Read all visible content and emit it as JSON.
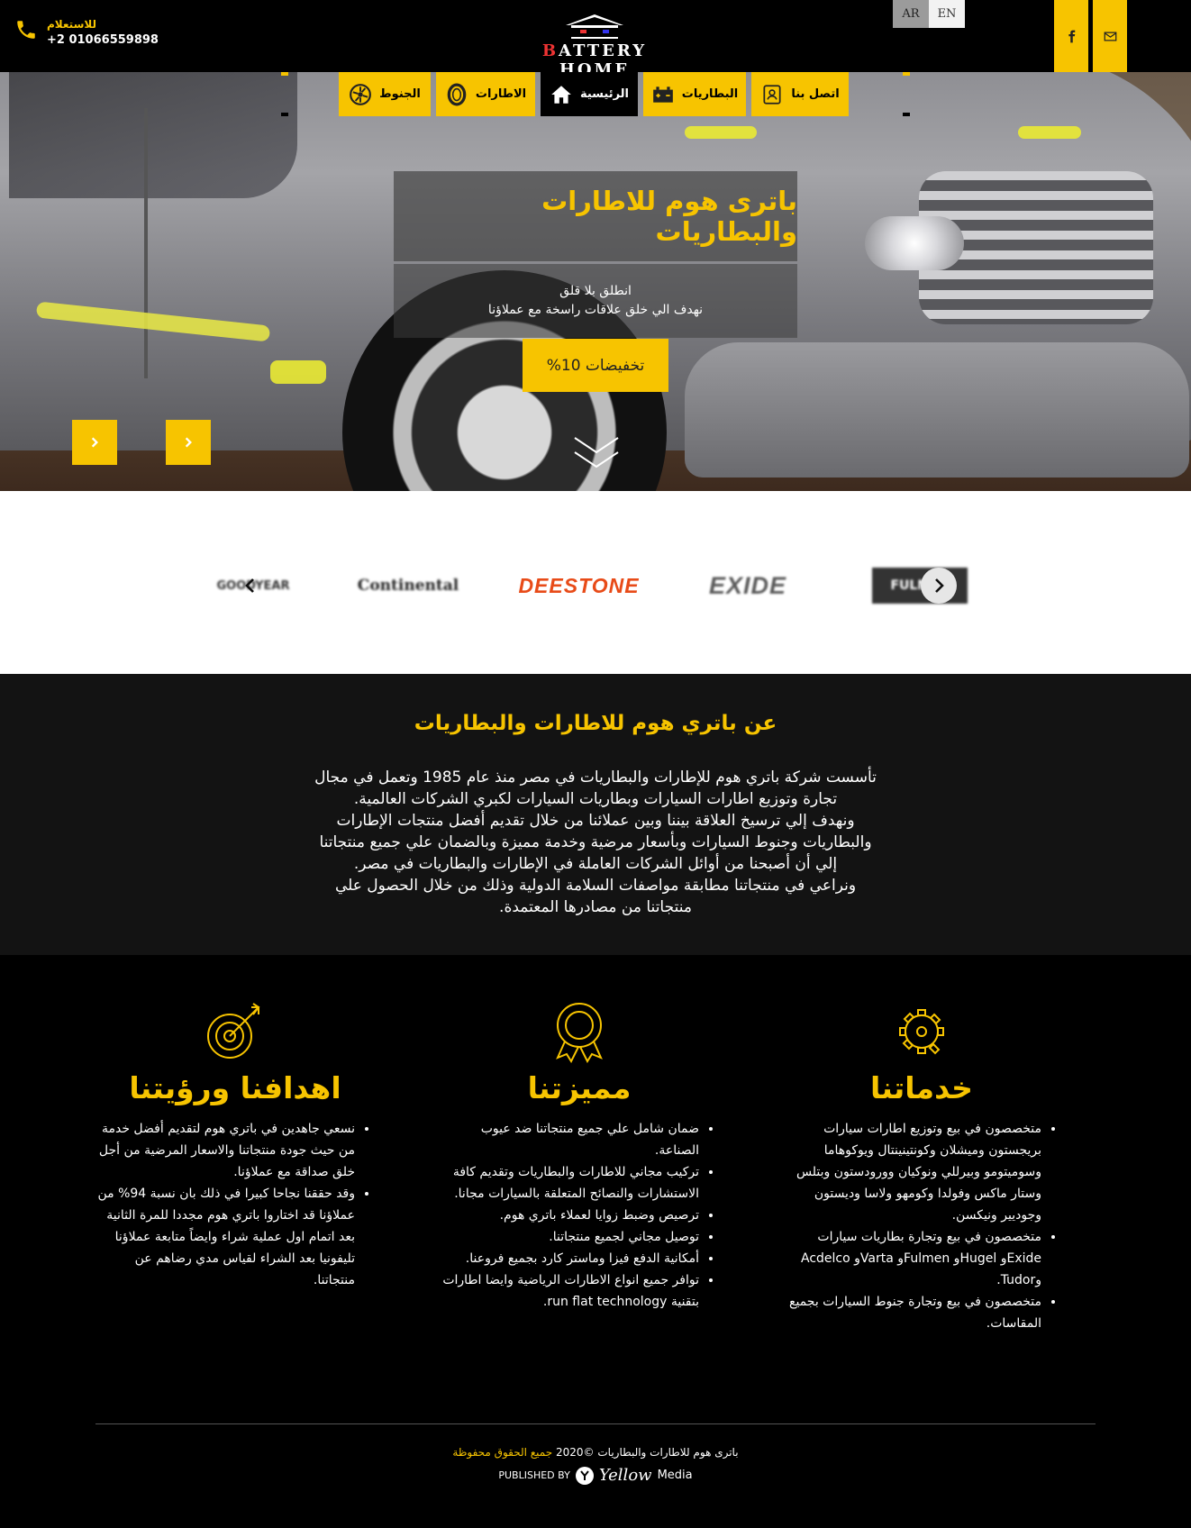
{
  "header": {
    "phone_label": "للاستعلام",
    "phone_number": "+2 01066559898",
    "logo": {
      "first_letter": "B",
      "rest": "ATTERY H",
      "o": "O",
      "end": "ME"
    },
    "lang_ar": "AR",
    "lang_en": "EN",
    "social": [
      {
        "icon": "facebook-icon"
      },
      {
        "icon": "mail-icon"
      }
    ]
  },
  "nav": {
    "items": [
      {
        "label": "الجنوط",
        "icon": "rim-icon"
      },
      {
        "label": "الاطارات",
        "icon": "tire-icon"
      },
      {
        "label": "الرئيسية",
        "icon": "home-icon",
        "active": true
      },
      {
        "label": "البطاريات",
        "icon": "battery-icon"
      },
      {
        "label": "اتصل بنا",
        "icon": "contact-icon"
      }
    ]
  },
  "hero": {
    "title": "باترى هوم للاطارات والبطاريات",
    "line1": "انطلق بلا قلق",
    "line2": "نهدف الي خلق علاقات راسخة مع عملاؤنا",
    "cta": "تخفيضات 10%"
  },
  "brands": {
    "items": [
      "GOODYEAR",
      "Continental",
      "DEESTONE",
      "EXIDE",
      "FULMEN"
    ]
  },
  "about": {
    "title": "عن باتري هوم للاطارات والبطاريات",
    "lines": [
      "تأسست شركة باتري هوم للإطارات والبطاريات في مصر منذ عام 1985 وتعمل في مجال",
      "تجارة وتوزيع اطارات السيارات وبطاريات السيارات لكبري الشركات العالمية.",
      "ونهدف إلي ترسيخ العلاقة بيننا وبين عملائنا من خلال تقديم أفضل منتجات الإطارات",
      "والبطاريات وجنوط السيارات وبأسعار مرضية وخدمة مميزة وبالضمان علي جميع منتجاتنا",
      "إلي أن أصبحنا من أوائل الشركات العاملة في الإطارات والبطاريات في مصر.",
      "ونراعي في منتجاتنا مطابقة مواصفات السلامة الدولية وذلك من خلال الحصول علي",
      "منتجاتنا من مصادرها المعتمدة."
    ]
  },
  "features": {
    "services": {
      "title": "خدماتنا",
      "icon": "gear-icon",
      "items": [
        "متخصصون في بيع وتوزيع اطارات سيارات بريجستون وميشلان وكونتينينتال ويوكوهاما وسوميتومو وبيرللي ونوكيان وورودستون وبتلس وستار ماكس وفولدا وكومهو ولاسا وديستون وجوديير ونيكسن.",
        "متخصصون في بيع وتجارة بطاريات سيارات Exideو Hugelو Fulmenو Vartaو Acdelco وTudor.",
        "متخصصون في بيع وتجارة جنوط السيارات بجميع المقاسات."
      ]
    },
    "advantages": {
      "title": "مميزتنا",
      "icon": "award-badge-icon",
      "items": [
        "ضمان شامل علي جميع منتجاتنا ضد عيوب الصناعة.",
        "تركيب مجاني للاطارات والبطاريات وتقديم كافة الاستشارات والنصائح المتعلقة بالسيارات مجانا.",
        "ترصيص وضبط زوايا لعملاء باتري هوم.",
        "توصيل مجاني لجميع منتجاتنا.",
        "أمكانية الدفع فيزا وماستر كارد بجميع فروعنا.",
        "توافر جميع انواع الاطارات الرياضية وايضا اطارات بتقنية run flat technology."
      ]
    },
    "goals": {
      "title": "اهدافنا ورؤيتنا",
      "icon": "target-icon",
      "items": [
        "نسعي جاهدين في باتري هوم لتقديم أفضل خدمة من حيث جودة منتجاتنا والاسعار المرضية من أجل خلق صداقة مع عملاؤنا.",
        "وقد حققنا نجاحا كبيرا في ذلك بان نسبة 94% من عملاؤنا قد اختاروا باتري هوم مجددا للمرة الثانية بعد اتمام اول عملية شراء وايضاً متابعة عملاؤنا تليفونيا بعد الشراء لقياس مدي رضاهم عن منتجاتنا."
      ]
    }
  },
  "footer": {
    "copyright": "باترى هوم للاطارات والبطاريات ©2020",
    "rights": "جميع الحقوق محفوظة",
    "published_by": "PUBLISHED BY",
    "publisher_logo": "Yellow",
    "publisher_media": "Media"
  },
  "colors": {
    "accent": "#f7c400",
    "background": "#000000",
    "about_bg": "#131313"
  }
}
